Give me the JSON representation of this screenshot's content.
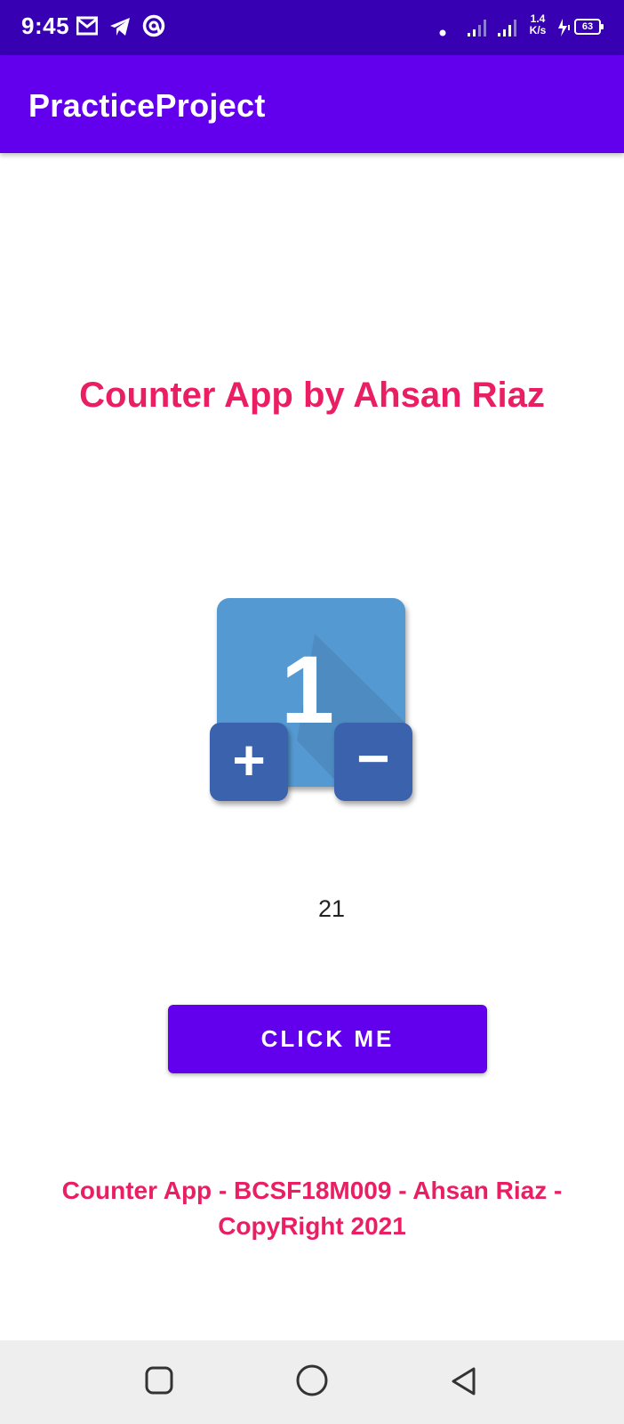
{
  "status_bar": {
    "time": "9:45",
    "net_speed_value": "1.4",
    "net_speed_unit": "K/s",
    "battery": "63",
    "icons": [
      "gmail-icon",
      "telegram-icon",
      "app-notification-icon",
      "dot-icon",
      "signal-icon",
      "signal-icon",
      "charging-icon",
      "battery-icon"
    ]
  },
  "app_bar": {
    "title": "PracticeProject"
  },
  "main": {
    "heading": "Counter App by Ahsan Riaz",
    "image": {
      "icon": "counter-app-icon",
      "digit": "1",
      "plus": "+",
      "minus": "−"
    },
    "count": "21",
    "button_label": "CLICK ME",
    "footer_line1": "Counter App - BCSF18M009 - Ahsan Riaz -",
    "footer_line2": "CopyRight 2021"
  },
  "nav_bar": {
    "icons": [
      "recents-icon",
      "home-icon",
      "back-icon"
    ]
  },
  "colors": {
    "status_bar": "#3700b3",
    "app_bar": "#6200ee",
    "accent": "#e91e63",
    "image_blue": "#5499d3",
    "image_dark_blue": "#3a62ad"
  }
}
